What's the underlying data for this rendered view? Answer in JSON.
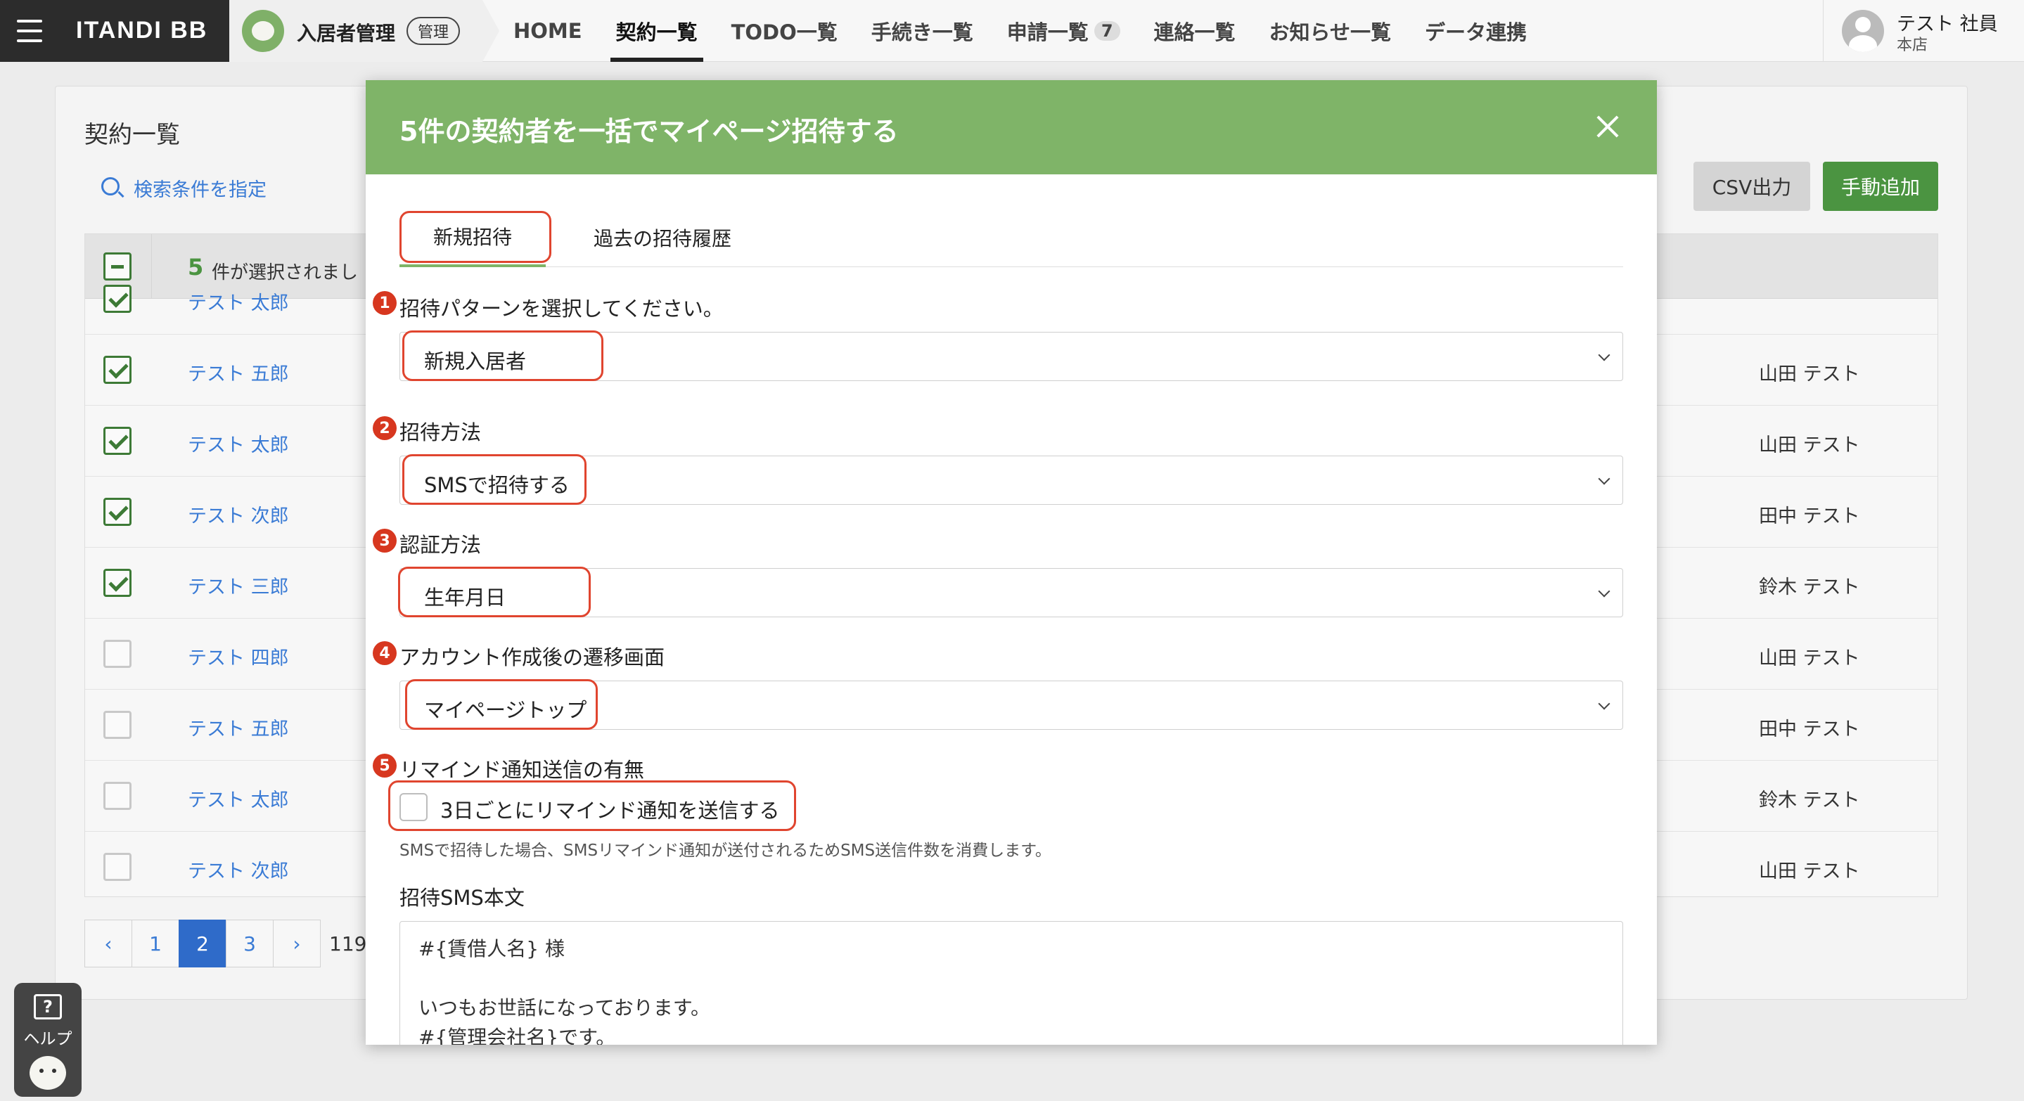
{
  "brand": {
    "name": "ITANDI BB"
  },
  "app": {
    "label": "入居者管理",
    "pill": "管理"
  },
  "nav": [
    {
      "label": "HOME"
    },
    {
      "label": "契約一覧",
      "active": true
    },
    {
      "label": "TODO一覧"
    },
    {
      "label": "手続き一覧"
    },
    {
      "label": "申請一覧",
      "count": "7"
    },
    {
      "label": "連絡一覧"
    },
    {
      "label": "お知らせ一覧"
    },
    {
      "label": "データ連携"
    }
  ],
  "user": {
    "name": "テスト 社員",
    "branch": "本店"
  },
  "page": {
    "title": "契約一覧",
    "search_label": "検索条件を指定",
    "csv_button": "CSV出力",
    "add_button": "手動追加"
  },
  "table": {
    "selected_count": "5",
    "selected_text": "件が選択されまし",
    "rows": [
      {
        "name": "テスト 太郎",
        "staff": "",
        "checked": true
      },
      {
        "name": "テスト 五郎",
        "staff": "山田 テスト",
        "checked": true
      },
      {
        "name": "テスト 太郎",
        "staff": "山田 テスト",
        "checked": true
      },
      {
        "name": "テスト 次郎",
        "staff": "田中 テスト",
        "checked": true
      },
      {
        "name": "テスト 三郎",
        "staff": "鈴木 テスト",
        "checked": true
      },
      {
        "name": "テスト 四郎",
        "staff": "山田 テスト",
        "checked": false
      },
      {
        "name": "テスト 五郎",
        "staff": "田中 テスト",
        "checked": false
      },
      {
        "name": "テスト 太郎",
        "staff": "鈴木 テスト",
        "checked": false
      },
      {
        "name": "テスト 次郎",
        "staff": "山田 テスト",
        "checked": false
      }
    ]
  },
  "pagination": {
    "prev": "‹",
    "next": "›",
    "pages": [
      "1",
      "2",
      "3"
    ],
    "current": "2",
    "total_partial": "119"
  },
  "help": {
    "label": "ヘルプ",
    "icon_glyph": "?"
  },
  "modal": {
    "title": "5件の契約者を一括でマイページ招待する",
    "tabs": [
      "新規招待",
      "過去の招待履歴"
    ],
    "fields": {
      "pattern": {
        "num": "1",
        "label": "招待パターンを選択してください。",
        "value": "新規入居者"
      },
      "method": {
        "num": "2",
        "label": "招待方法",
        "value": "SMSで招待する"
      },
      "auth": {
        "num": "3",
        "label": "認証方法",
        "value": "生年月日"
      },
      "destination": {
        "num": "4",
        "label": "アカウント作成後の遷移画面",
        "value": "マイページトップ"
      },
      "remind": {
        "num": "5",
        "label": "リマインド通知送信の有無",
        "checkbox_label": "3日ごとにリマインド通知を送信する",
        "checked": false
      }
    },
    "note": "SMSで招待した場合、SMSリマインド通知が送付されるためSMS送信件数を消費します。",
    "sms_body_label": "招待SMS本文",
    "sms_body": "#{賃借人名} 様\n\nいつもお世話になっております。\n#{管理会社名}です。"
  },
  "colors": {
    "modal_header": "#7fb468",
    "highlight": "#e0452f",
    "accent_green": "#4b9441",
    "link_blue": "#3a7bd5"
  }
}
